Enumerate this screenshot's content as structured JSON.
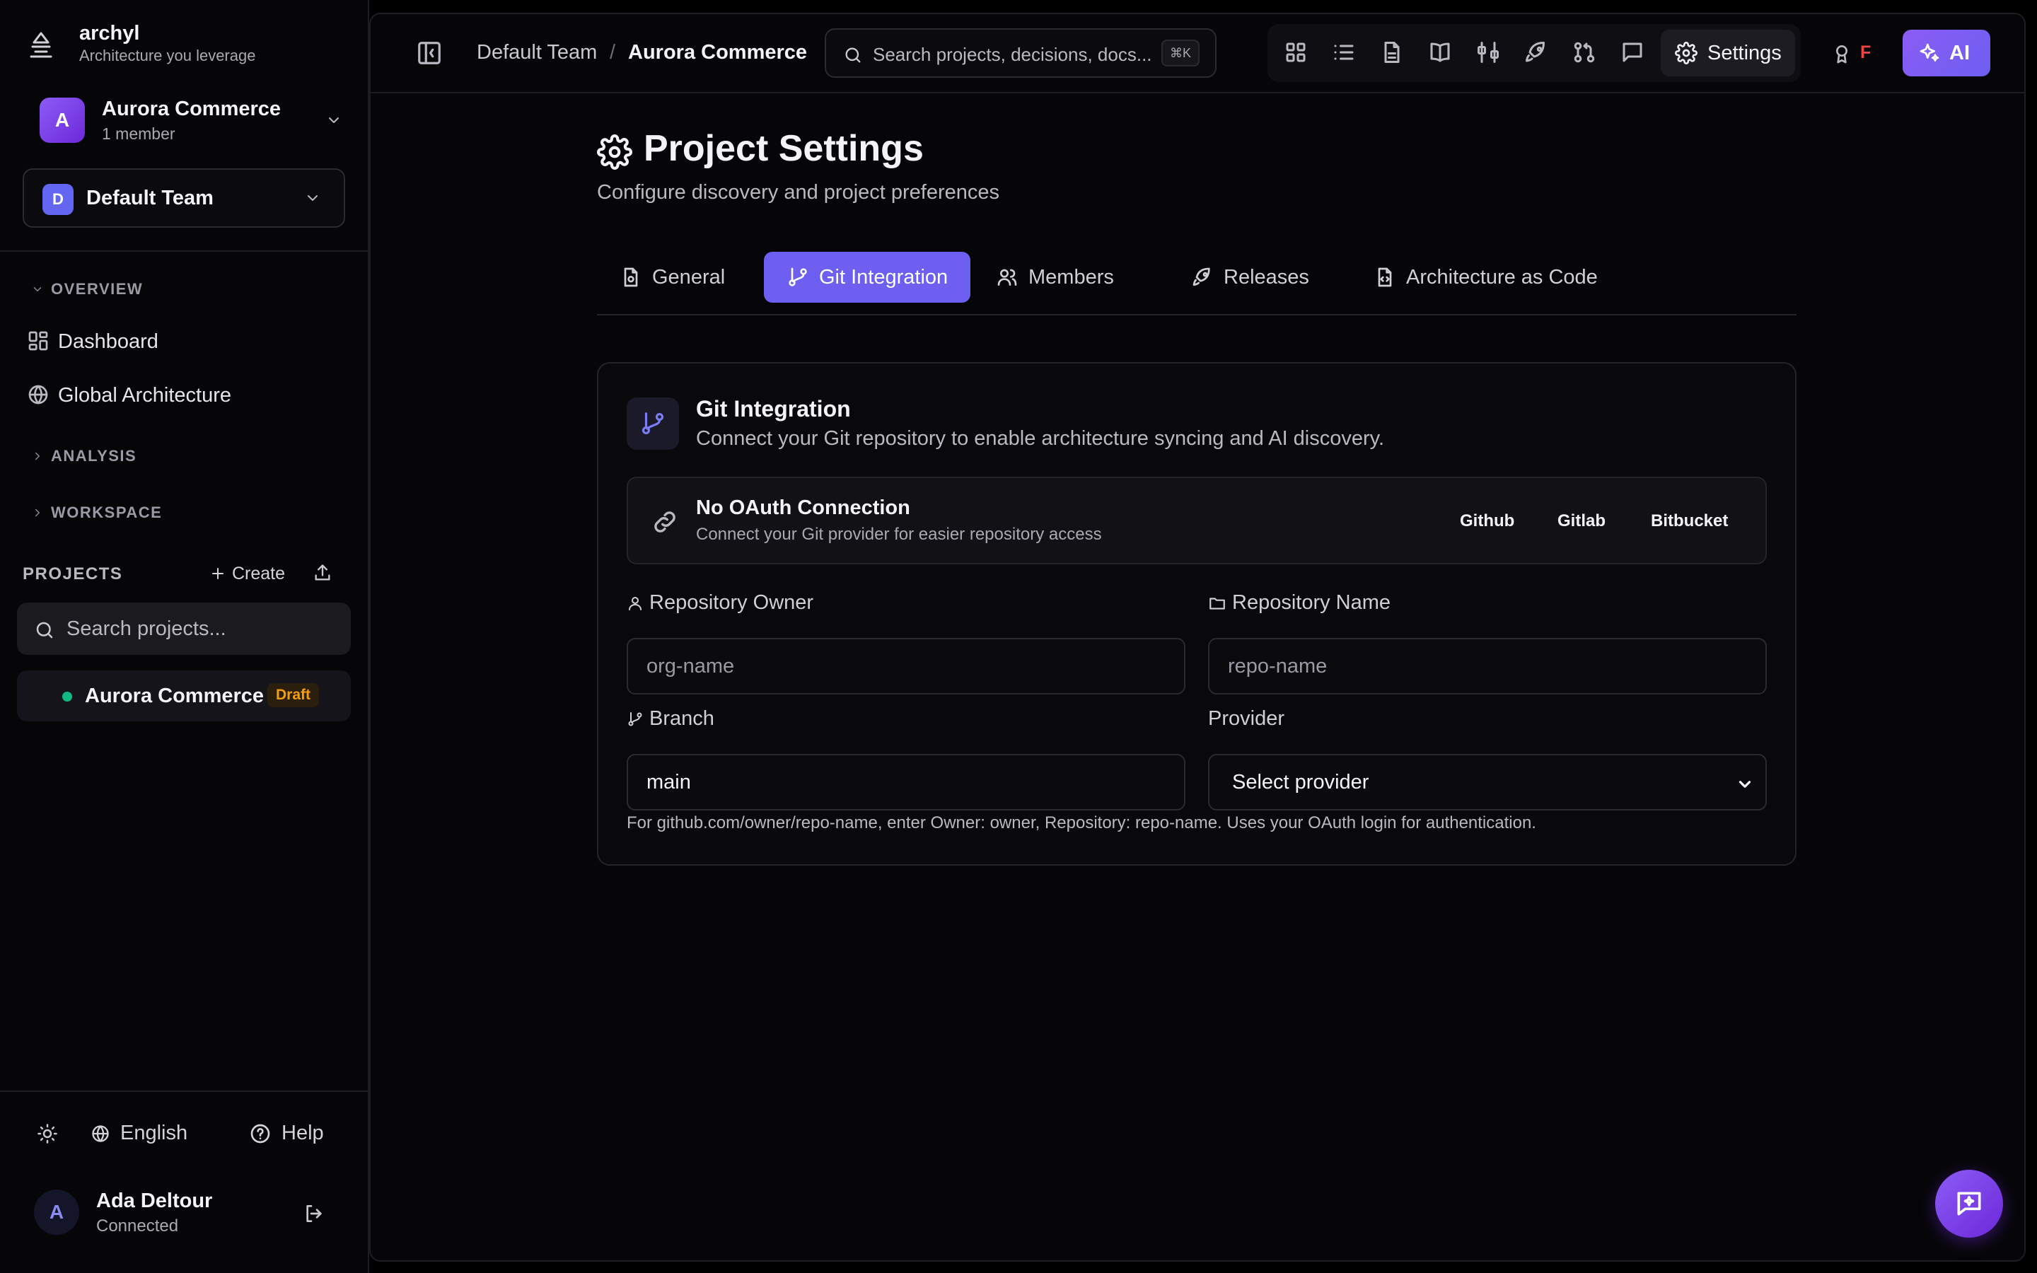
{
  "brand": {
    "name": "archyl",
    "tagline": "Architecture you leverage"
  },
  "project_switcher": {
    "avatar": "A",
    "name": "Aurora Commerce",
    "members": "1 member"
  },
  "team_switcher": {
    "avatar": "D",
    "name": "Default Team"
  },
  "sidebar": {
    "sections": [
      {
        "label": "OVERVIEW",
        "expanded": true
      },
      {
        "label": "ANALYSIS",
        "expanded": false
      },
      {
        "label": "WORKSPACE",
        "expanded": false
      }
    ],
    "overview_items": [
      {
        "label": "Dashboard",
        "icon": "dashboard-icon"
      },
      {
        "label": "Global Architecture",
        "icon": "globe-icon"
      }
    ],
    "projects_label": "PROJECTS",
    "create_label": "Create",
    "search_placeholder": "Search projects...",
    "projects": [
      {
        "name": "Aurora Commerce",
        "badge": "Draft",
        "status_color": "#10b981"
      }
    ],
    "footer": {
      "language": "English",
      "help": "Help"
    },
    "user": {
      "avatar": "A",
      "name": "Ada Deltour",
      "status": "Connected"
    }
  },
  "topbar": {
    "breadcrumb": {
      "team": "Default Team",
      "separator": "/",
      "project": "Aurora Commerce"
    },
    "search_placeholder": "Search projects, decisions, docs...",
    "search_shortcut": "⌘K",
    "tools": [
      "grid-icon",
      "list-icon",
      "document-icon",
      "book-icon",
      "compare-icon",
      "rocket-icon",
      "git-pull-request-icon",
      "chat-icon"
    ],
    "settings_label": "Settings",
    "award_letter": "F",
    "ai_label": "AI"
  },
  "page": {
    "title": "Project Settings",
    "subtitle": "Configure discovery and project preferences",
    "tabs": [
      {
        "label": "General",
        "active": false
      },
      {
        "label": "Git Integration",
        "active": true
      },
      {
        "label": "Members",
        "active": false
      },
      {
        "label": "Releases",
        "active": false
      },
      {
        "label": "Architecture as Code",
        "active": false
      }
    ]
  },
  "git_card": {
    "title": "Git Integration",
    "subtitle": "Connect your Git repository to enable architecture syncing and AI discovery.",
    "oauth": {
      "title": "No OAuth Connection",
      "subtitle": "Connect your Git provider for easier repository access",
      "providers": [
        "Github",
        "Gitlab",
        "Bitbucket"
      ]
    },
    "fields": {
      "owner": {
        "label": "Repository Owner",
        "placeholder": "org-name",
        "value": ""
      },
      "name": {
        "label": "Repository Name",
        "placeholder": "repo-name",
        "value": ""
      },
      "branch": {
        "label": "Branch",
        "placeholder": "",
        "value": "main"
      },
      "provider": {
        "label": "Provider",
        "value": "Select provider"
      }
    },
    "hint": "For github.com/owner/repo-name, enter Owner: owner, Repository: repo-name. Uses your OAuth login for authentication."
  },
  "colors": {
    "accent": "#6d5ff0",
    "background": "#000000",
    "status_green": "#10b981",
    "draft_badge": "#f59e0b",
    "award_red": "#ef4444"
  }
}
